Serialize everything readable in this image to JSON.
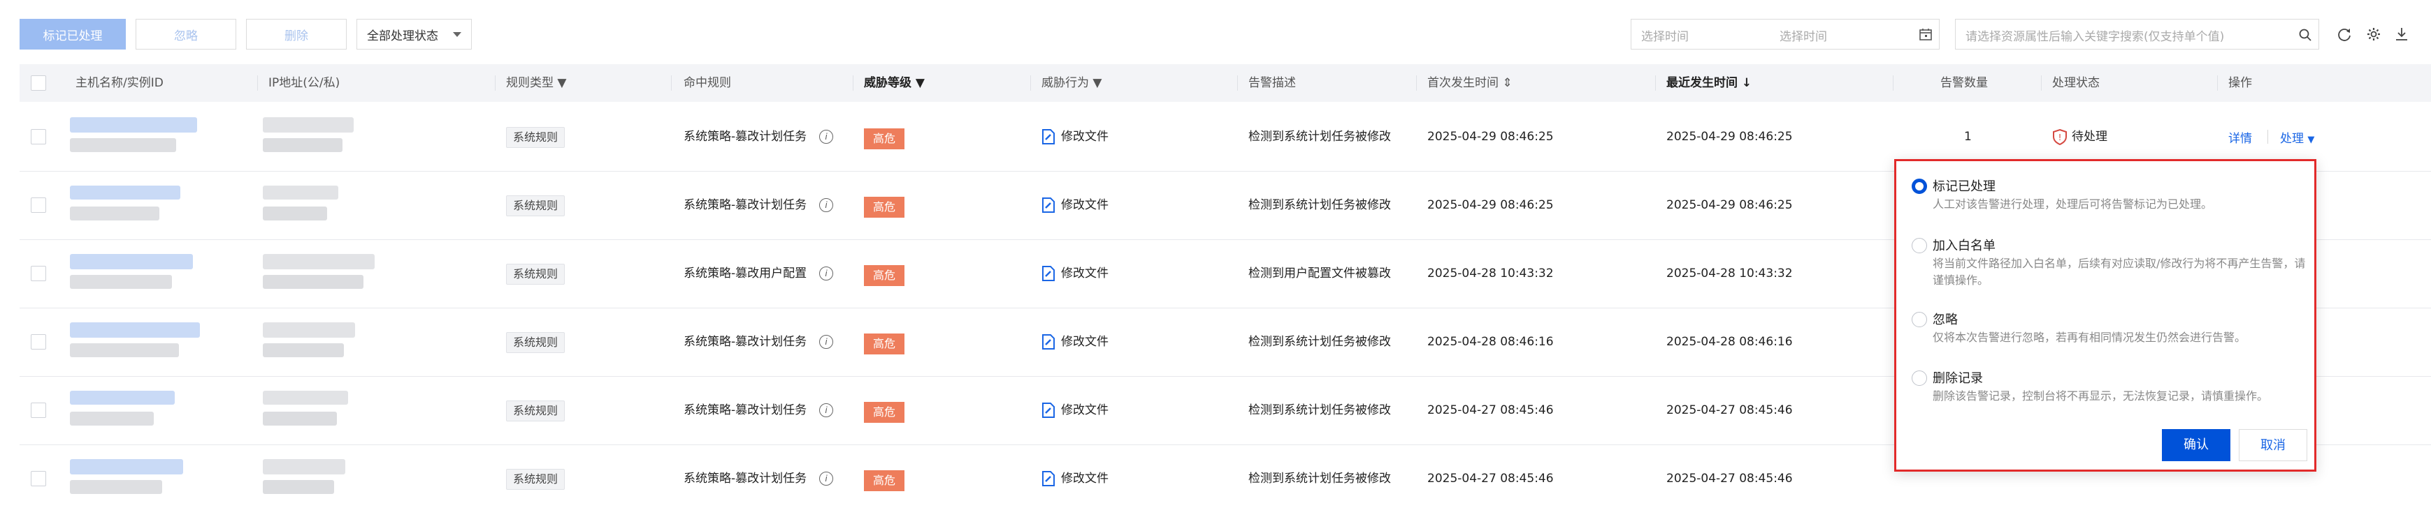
{
  "toolbar": {
    "mark_handled": "标记已处理",
    "ignore": "忽略",
    "delete": "删除",
    "status_filter": "全部处理状态",
    "date_start_placeholder": "选择时间",
    "date_end_placeholder": "选择时间",
    "search_placeholder": "请选择资源属性后输入关键字搜索(仅支持单个值)"
  },
  "table": {
    "headers": {
      "host": "主机名称/实例ID",
      "ip": "IP地址(公/私)",
      "rule_type": "规则类型",
      "hit_rule": "命中规则",
      "threat_level": "威胁等级",
      "threat_action": "威胁行为",
      "alert_desc": "告警描述",
      "first_time": "首次发生时间",
      "last_time": "最近发生时间",
      "alert_count": "告警数量",
      "status": "处理状态",
      "actions": "操作"
    },
    "rows": [
      {
        "rule_type": "系统规则",
        "hit_rule": "系统策略-篡改计划任务",
        "level": "高危",
        "action": "修改文件",
        "desc": "检测到系统计划任务被修改",
        "first": "2025-04-29 08:46:25",
        "last": "2025-04-29 08:46:25",
        "count": "1",
        "status": "待处理",
        "detail": "详情",
        "handle": "处理"
      },
      {
        "rule_type": "系统规则",
        "hit_rule": "系统策略-篡改计划任务",
        "level": "高危",
        "action": "修改文件",
        "desc": "检测到系统计划任务被修改",
        "first": "2025-04-29 08:46:25",
        "last": "2025-04-29 08:46:25"
      },
      {
        "rule_type": "系统规则",
        "hit_rule": "系统策略-篡改用户配置",
        "level": "高危",
        "action": "修改文件",
        "desc": "检测到用户配置文件被篡改",
        "first": "2025-04-28 10:43:32",
        "last": "2025-04-28 10:43:32"
      },
      {
        "rule_type": "系统规则",
        "hit_rule": "系统策略-篡改计划任务",
        "level": "高危",
        "action": "修改文件",
        "desc": "检测到系统计划任务被修改",
        "first": "2025-04-28 08:46:16",
        "last": "2025-04-28 08:46:16"
      },
      {
        "rule_type": "系统规则",
        "hit_rule": "系统策略-篡改计划任务",
        "level": "高危",
        "action": "修改文件",
        "desc": "检测到系统计划任务被修改",
        "first": "2025-04-27 08:45:46",
        "last": "2025-04-27 08:45:46"
      },
      {
        "rule_type": "系统规则",
        "hit_rule": "系统策略-篡改计划任务",
        "level": "高危",
        "action": "修改文件",
        "desc": "检测到系统计划任务被修改",
        "first": "2025-04-27 08:45:46",
        "last": "2025-04-27 08:45:46"
      }
    ]
  },
  "popover": {
    "options": [
      {
        "title": "标记已处理",
        "desc": "人工对该告警进行处理，处理后可将告警标记为已处理。",
        "selected": true
      },
      {
        "title": "加入白名单",
        "desc": "将当前文件路径加入白名单，后续有对应读取/修改行为将不再产生告警，请谨慎操作。",
        "selected": false
      },
      {
        "title": "忽略",
        "desc": "仅将本次告警进行忽略，若再有相同情况发生仍然会进行告警。",
        "selected": false
      },
      {
        "title": "删除记录",
        "desc": "删除该告警记录，控制台将不再显示，无法恢复记录，请慎重操作。",
        "selected": false
      }
    ],
    "confirm": "确认",
    "cancel": "取消"
  },
  "colors": {
    "primary": "#0052d9",
    "danger": "#ee7d5b",
    "highlight_border": "#e22a2a"
  }
}
